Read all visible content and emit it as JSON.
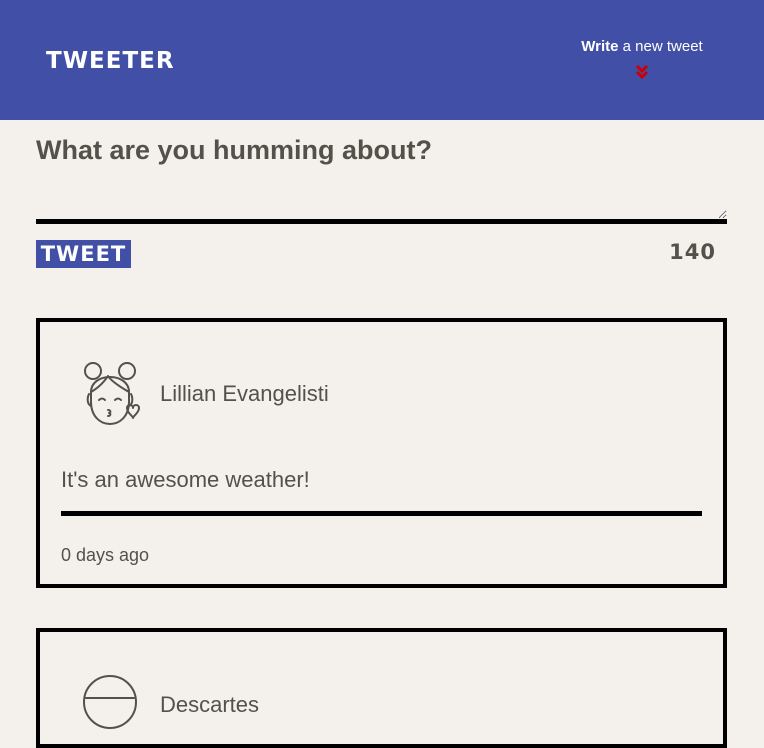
{
  "nav": {
    "brand": "TWEETER",
    "write_strong": "Write",
    "write_rest": " a new tweet",
    "chevron_icon": "double-chevron-down-icon",
    "chevron_color": "#cc0000"
  },
  "compose": {
    "question": "What are you humming about?",
    "textarea_value": "",
    "button_label": "TWEET",
    "counter": "140"
  },
  "tweets": [
    {
      "author": "Lillian Evangelisti",
      "avatar_icon": "girl-blowing-kiss-avatar-icon",
      "content": "It's an awesome weather!",
      "timestamp": "0 days ago"
    },
    {
      "author": "Descartes",
      "avatar_icon": "person-avatar-icon"
    }
  ],
  "colors": {
    "nav_bg": "#4150a6",
    "page_bg": "#f4f1ec",
    "text": "#545149"
  }
}
